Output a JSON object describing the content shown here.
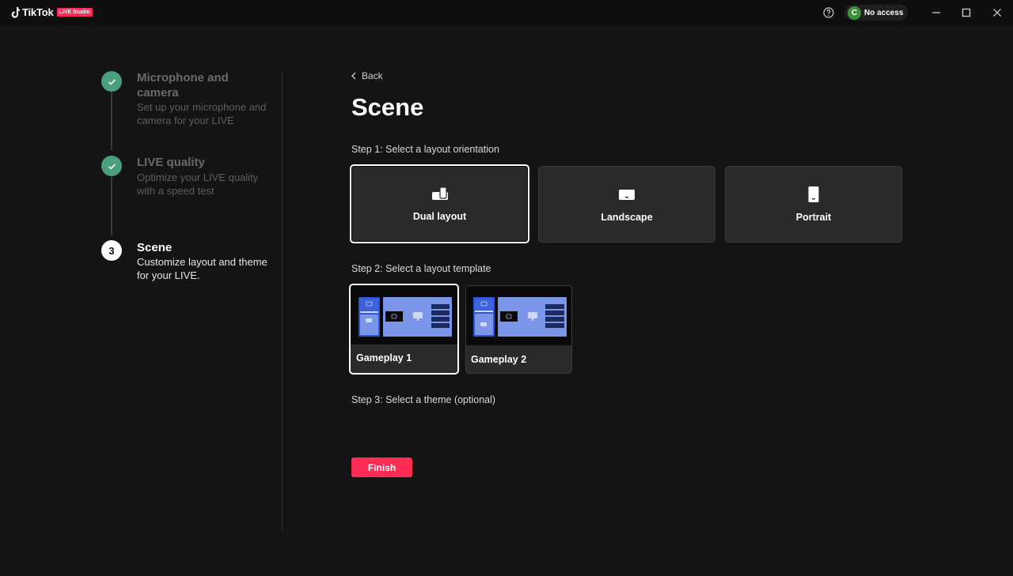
{
  "titlebar": {
    "app_name": "TikTok",
    "app_badge": "LIVE Studio",
    "user_initial": "C",
    "user_status": "No access"
  },
  "stepper": {
    "steps": [
      {
        "index": "1",
        "title": "Microphone and camera",
        "description": "Set up your microphone and camera for your LIVE",
        "state": "done"
      },
      {
        "index": "2",
        "title": "LIVE quality",
        "description": "Optimize your LIVE quality with a speed test",
        "state": "done"
      },
      {
        "index": "3",
        "title": "Scene",
        "description": "Customize layout and theme for your LIVE.",
        "state": "current"
      }
    ]
  },
  "main": {
    "back_label": "Back",
    "title": "Scene",
    "step1_label": "Step 1: Select a layout orientation",
    "orientations": [
      {
        "label": "Dual layout",
        "icon": "dual-layout-icon",
        "selected": true
      },
      {
        "label": "Landscape",
        "icon": "landscape-icon",
        "selected": false
      },
      {
        "label": "Portrait",
        "icon": "portrait-icon",
        "selected": false
      }
    ],
    "step2_label": "Step 2: Select a layout template",
    "templates": [
      {
        "label": "Gameplay 1",
        "selected": true
      },
      {
        "label": "Gameplay 2",
        "selected": false
      }
    ],
    "step3_label": "Step 3: Select a theme (optional)",
    "finish_label": "Finish"
  },
  "colors": {
    "accent": "#fe2c55",
    "done_step": "#48a07c",
    "preview_blue": "#7b95e8",
    "preview_dark_blue": "#2f55d4",
    "background": "#141414",
    "card": "#2a2a2a"
  }
}
